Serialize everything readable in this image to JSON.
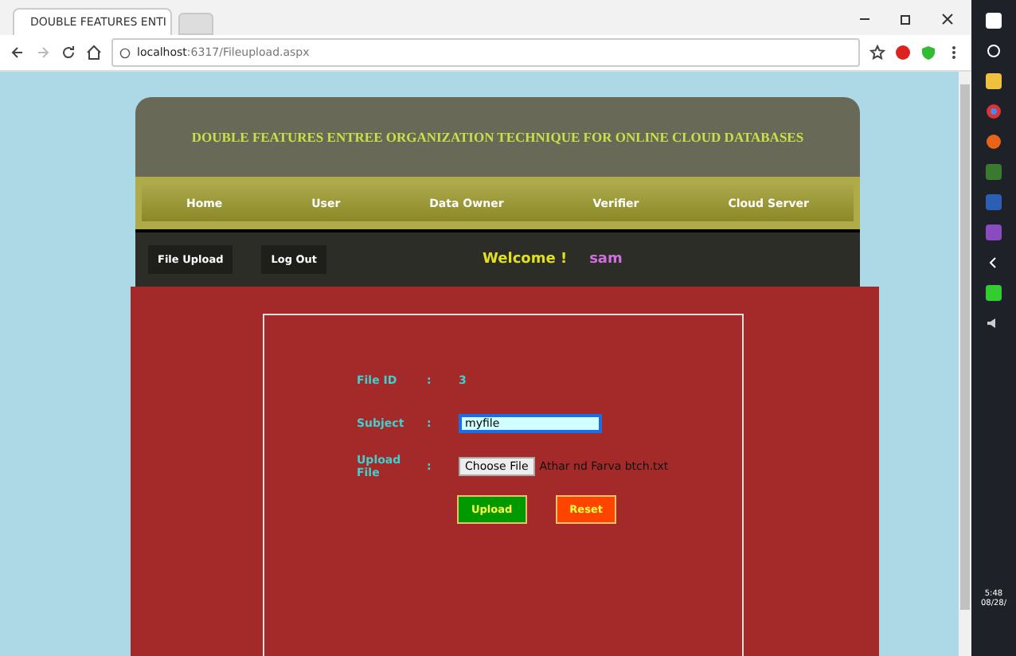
{
  "browser": {
    "tab_title": "DOUBLE FEATURES ENTI",
    "url_host": "localhost",
    "url_path": ":6317/Fileupload.aspx"
  },
  "site": {
    "title": "DOUBLE FEATURES ENTREE ORGANIZATION TECHNIQUE FOR ONLINE CLOUD DATABASES",
    "nav": [
      "Home",
      "User",
      "Data Owner",
      "Verifier",
      "Cloud Server"
    ],
    "actions": [
      "File Upload",
      "Log Out"
    ],
    "welcome": "Welcome !",
    "user": "sam"
  },
  "form": {
    "rows": [
      {
        "kind": "text",
        "label": "File ID",
        "colon": ":",
        "value": "3"
      },
      {
        "kind": "input",
        "label": "Subject",
        "colon": ":",
        "value": "myfile"
      },
      {
        "kind": "file",
        "label": "Upload File",
        "colon": ":",
        "button": "Choose File",
        "value": "Athar  nd Farva btch.txt"
      }
    ],
    "buttons": [
      {
        "kind": "primary",
        "label": "Upload"
      },
      {
        "kind": "reset",
        "label": "Reset"
      }
    ]
  },
  "taskbar": {
    "time": "5:48",
    "date": "08/28/"
  }
}
